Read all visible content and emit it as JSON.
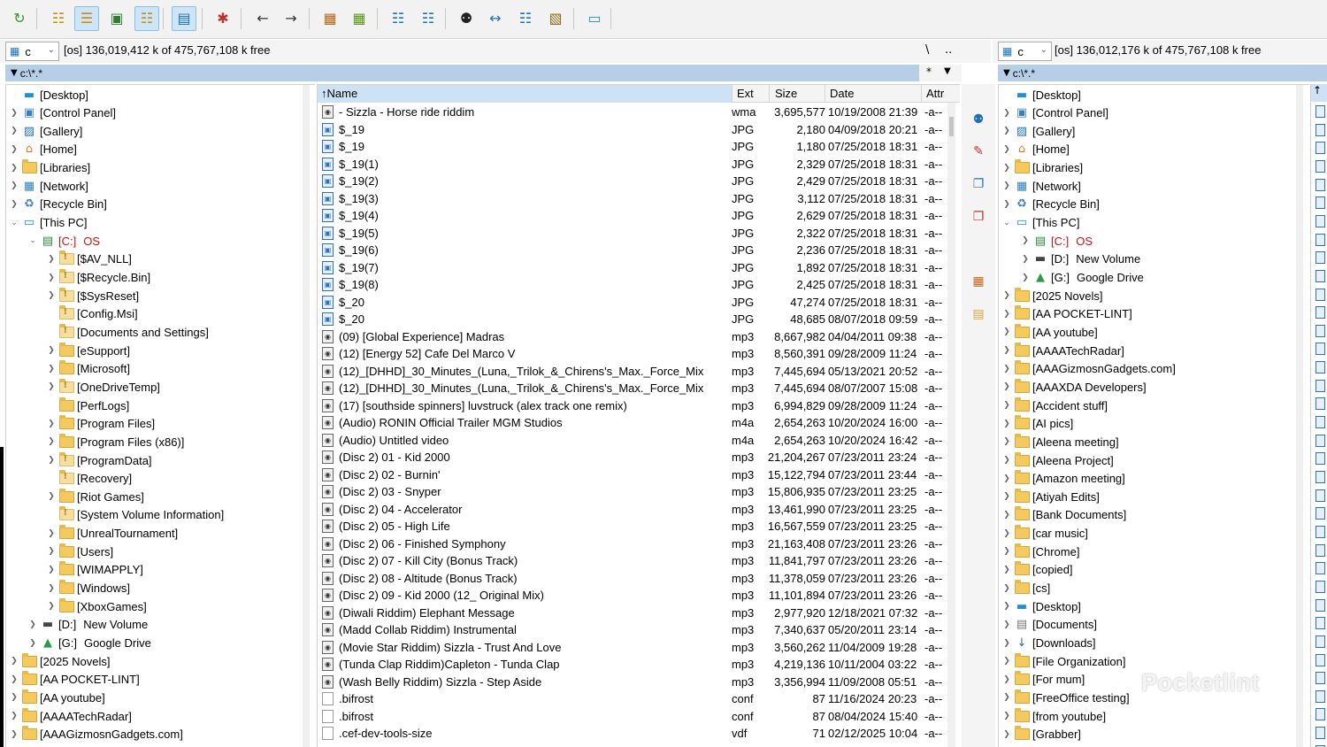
{
  "toolbar": {
    "buttons": [
      "refresh-icon",
      "brief-view-icon",
      "detailed-view-icon",
      "thumbnails-icon",
      "tree-view-icon",
      "quick-view-icon",
      "select-icon",
      "back-icon",
      "forward-icon",
      "pack-icon",
      "unpack-icon",
      "ftp-connect-icon",
      "url-connect-icon",
      "find-icon",
      "sync-dirs-icon",
      "compare-icon",
      "multi-rename-icon",
      "notepad-icon"
    ]
  },
  "left_drive": {
    "letter": "c",
    "info": "[os]  136,019,412 k of 475,767,108 k free",
    "root_btn": "\\",
    "up_btn": "..",
    "path": "c:\\*.*",
    "star": "*"
  },
  "right_drive": {
    "letter": "c",
    "info": "[os]  136,012,176 k of 475,767,108 k free",
    "path": "c:\\*.*"
  },
  "left_tree": [
    {
      "label": "[Desktop]",
      "icon": "desktop",
      "level": 0,
      "tog": ""
    },
    {
      "label": "[Control Panel]",
      "icon": "control-panel",
      "level": 0,
      "tog": ">"
    },
    {
      "label": "[Gallery]",
      "icon": "gallery",
      "level": 0,
      "tog": ">"
    },
    {
      "label": "[Home]",
      "icon": "home",
      "level": 0,
      "tog": ">"
    },
    {
      "label": "[Libraries]",
      "icon": "folder",
      "level": 0,
      "tog": ">"
    },
    {
      "label": "[Network]",
      "icon": "network",
      "level": 0,
      "tog": ">"
    },
    {
      "label": "[Recycle Bin]",
      "icon": "recycle",
      "level": 0,
      "tog": ">"
    },
    {
      "label": "[This PC]",
      "icon": "pc",
      "level": 0,
      "tog": "v"
    },
    {
      "label": "[C:]",
      "label2": "OS",
      "icon": "drive",
      "level": 1,
      "tog": "v",
      "red": true
    },
    {
      "label": "[$AV_NLL]",
      "icon": "sysfolder",
      "level": 2,
      "tog": ">"
    },
    {
      "label": "[$Recycle.Bin]",
      "icon": "sysfolder",
      "level": 2,
      "tog": ">"
    },
    {
      "label": "[$SysReset]",
      "icon": "sysfolder",
      "level": 2,
      "tog": ">"
    },
    {
      "label": "[Config.Msi]",
      "icon": "sysfolder",
      "level": 2,
      "tog": ""
    },
    {
      "label": "[Documents and Settings]",
      "icon": "sysfolder",
      "level": 2,
      "tog": ""
    },
    {
      "label": "[eSupport]",
      "icon": "folder",
      "level": 2,
      "tog": ">"
    },
    {
      "label": "[Microsoft]",
      "icon": "folder",
      "level": 2,
      "tog": ">"
    },
    {
      "label": "[OneDriveTemp]",
      "icon": "sysfolder",
      "level": 2,
      "tog": ">"
    },
    {
      "label": "[PerfLogs]",
      "icon": "folder",
      "level": 2,
      "tog": ""
    },
    {
      "label": "[Program Files]",
      "icon": "folder",
      "level": 2,
      "tog": ">"
    },
    {
      "label": "[Program Files (x86)]",
      "icon": "folder",
      "level": 2,
      "tog": ">"
    },
    {
      "label": "[ProgramData]",
      "icon": "sysfolder",
      "level": 2,
      "tog": ">"
    },
    {
      "label": "[Recovery]",
      "icon": "sysfolder",
      "level": 2,
      "tog": ""
    },
    {
      "label": "[Riot Games]",
      "icon": "folder",
      "level": 2,
      "tog": ">"
    },
    {
      "label": "[System Volume Information]",
      "icon": "sysfolder",
      "level": 2,
      "tog": ""
    },
    {
      "label": "[UnrealTournament]",
      "icon": "folder",
      "level": 2,
      "tog": ">"
    },
    {
      "label": "[Users]",
      "icon": "folder",
      "level": 2,
      "tog": ">"
    },
    {
      "label": "[WIMAPPLY]",
      "icon": "folder",
      "level": 2,
      "tog": ">"
    },
    {
      "label": "[Windows]",
      "icon": "folder",
      "level": 2,
      "tog": ">"
    },
    {
      "label": "[XboxGames]",
      "icon": "folder",
      "level": 2,
      "tog": ">"
    },
    {
      "label": "[D:]",
      "label2": "New Volume",
      "icon": "hdd",
      "level": 1,
      "tog": ">"
    },
    {
      "label": "[G:]",
      "label2": "Google Drive",
      "icon": "gdrive",
      "level": 1,
      "tog": ">"
    },
    {
      "label": "[2025 Novels]",
      "icon": "folder",
      "level": 0,
      "tog": ">"
    },
    {
      "label": "[AA POCKET-LINT]",
      "icon": "folder",
      "level": 0,
      "tog": ">"
    },
    {
      "label": "[AA youtube]",
      "icon": "folder",
      "level": 0,
      "tog": ">"
    },
    {
      "label": "[AAAATechRadar]",
      "icon": "folder",
      "level": 0,
      "tog": ">"
    },
    {
      "label": "[AAAGizmosnGadgets.com]",
      "icon": "folder",
      "level": 0,
      "tog": ">"
    }
  ],
  "right_tree": [
    {
      "label": "[Desktop]",
      "icon": "desktop",
      "level": 0,
      "tog": ""
    },
    {
      "label": "[Control Panel]",
      "icon": "control-panel",
      "level": 0,
      "tog": ">"
    },
    {
      "label": "[Gallery]",
      "icon": "gallery",
      "level": 0,
      "tog": ">"
    },
    {
      "label": "[Home]",
      "icon": "home",
      "level": 0,
      "tog": ">"
    },
    {
      "label": "[Libraries]",
      "icon": "folder",
      "level": 0,
      "tog": ">"
    },
    {
      "label": "[Network]",
      "icon": "network",
      "level": 0,
      "tog": ">"
    },
    {
      "label": "[Recycle Bin]",
      "icon": "recycle",
      "level": 0,
      "tog": ">"
    },
    {
      "label": "[This PC]",
      "icon": "pc",
      "level": 0,
      "tog": "v"
    },
    {
      "label": "[C:]",
      "label2": "OS",
      "icon": "drive",
      "level": 1,
      "tog": ">",
      "red": true
    },
    {
      "label": "[D:]",
      "label2": "New Volume",
      "icon": "hdd",
      "level": 1,
      "tog": ">"
    },
    {
      "label": "[G:]",
      "label2": "Google Drive",
      "icon": "gdrive",
      "level": 1,
      "tog": ">"
    },
    {
      "label": "[2025 Novels]",
      "icon": "folder",
      "level": 0,
      "tog": ">"
    },
    {
      "label": "[AA POCKET-LINT]",
      "icon": "folder",
      "level": 0,
      "tog": ">"
    },
    {
      "label": "[AA youtube]",
      "icon": "folder",
      "level": 0,
      "tog": ">"
    },
    {
      "label": "[AAAATechRadar]",
      "icon": "folder",
      "level": 0,
      "tog": ">"
    },
    {
      "label": "[AAAGizmosnGadgets.com]",
      "icon": "folder",
      "level": 0,
      "tog": ">"
    },
    {
      "label": "[AAAXDA Developers]",
      "icon": "folder",
      "level": 0,
      "tog": ">"
    },
    {
      "label": "[Accident stuff]",
      "icon": "folder",
      "level": 0,
      "tog": ">"
    },
    {
      "label": "[AI pics]",
      "icon": "folder",
      "level": 0,
      "tog": ">"
    },
    {
      "label": "[Aleena meeting]",
      "icon": "folder",
      "level": 0,
      "tog": ">"
    },
    {
      "label": "[Aleena Project]",
      "icon": "folder",
      "level": 0,
      "tog": ">"
    },
    {
      "label": "[Amazon meeting]",
      "icon": "folder",
      "level": 0,
      "tog": ">"
    },
    {
      "label": "[Atiyah Edits]",
      "icon": "folder",
      "level": 0,
      "tog": ">"
    },
    {
      "label": "[Bank Documents]",
      "icon": "folder",
      "level": 0,
      "tog": ">"
    },
    {
      "label": "[car music]",
      "icon": "folder",
      "level": 0,
      "tog": ">"
    },
    {
      "label": "[Chrome]",
      "icon": "folder",
      "level": 0,
      "tog": ">"
    },
    {
      "label": "[copied]",
      "icon": "folder",
      "level": 0,
      "tog": ">"
    },
    {
      "label": "[cs]",
      "icon": "folder",
      "level": 0,
      "tog": ">"
    },
    {
      "label": "[Desktop]",
      "icon": "desktop",
      "level": 0,
      "tog": ">"
    },
    {
      "label": "[Documents]",
      "icon": "documents",
      "level": 0,
      "tog": ">"
    },
    {
      "label": "[Downloads]",
      "icon": "downloads",
      "level": 0,
      "tog": ">"
    },
    {
      "label": "[File Organization]",
      "icon": "folder",
      "level": 0,
      "tog": ">"
    },
    {
      "label": "[For mum]",
      "icon": "folder",
      "level": 0,
      "tog": ">"
    },
    {
      "label": "[FreeOffice testing]",
      "icon": "folder",
      "level": 0,
      "tog": ">"
    },
    {
      "label": "[from youtube]",
      "icon": "folder",
      "level": 0,
      "tog": ">"
    },
    {
      "label": "[Grabber]",
      "icon": "folder",
      "level": 0,
      "tog": ">"
    }
  ],
  "filelist": {
    "headers": {
      "name": "Name",
      "ext": "Ext",
      "size": "Size",
      "date": "Date",
      "attr": "Attr"
    },
    "sort_arrow": "↑",
    "rows": [
      {
        "name": "- Sizzla - Horse ride riddim",
        "ext": "wma",
        "size": "3,695,577",
        "date": "10/19/2008 21:39",
        "attr": "-a--",
        "type": "aud"
      },
      {
        "name": "$_19",
        "ext": "JPG",
        "size": "2,180",
        "date": "04/09/2018 20:21",
        "attr": "-a--",
        "type": "img"
      },
      {
        "name": "$_19",
        "ext": "JPG",
        "size": "1,180",
        "date": "07/25/2018 18:31",
        "attr": "-a--",
        "type": "img"
      },
      {
        "name": "$_19(1)",
        "ext": "JPG",
        "size": "2,329",
        "date": "07/25/2018 18:31",
        "attr": "-a--",
        "type": "img"
      },
      {
        "name": "$_19(2)",
        "ext": "JPG",
        "size": "2,429",
        "date": "07/25/2018 18:31",
        "attr": "-a--",
        "type": "img"
      },
      {
        "name": "$_19(3)",
        "ext": "JPG",
        "size": "3,112",
        "date": "07/25/2018 18:31",
        "attr": "-a--",
        "type": "img"
      },
      {
        "name": "$_19(4)",
        "ext": "JPG",
        "size": "2,629",
        "date": "07/25/2018 18:31",
        "attr": "-a--",
        "type": "img"
      },
      {
        "name": "$_19(5)",
        "ext": "JPG",
        "size": "2,322",
        "date": "07/25/2018 18:31",
        "attr": "-a--",
        "type": "img"
      },
      {
        "name": "$_19(6)",
        "ext": "JPG",
        "size": "2,236",
        "date": "07/25/2018 18:31",
        "attr": "-a--",
        "type": "img"
      },
      {
        "name": "$_19(7)",
        "ext": "JPG",
        "size": "1,892",
        "date": "07/25/2018 18:31",
        "attr": "-a--",
        "type": "img"
      },
      {
        "name": "$_19(8)",
        "ext": "JPG",
        "size": "2,425",
        "date": "07/25/2018 18:31",
        "attr": "-a--",
        "type": "img"
      },
      {
        "name": "$_20",
        "ext": "JPG",
        "size": "47,274",
        "date": "07/25/2018 18:31",
        "attr": "-a--",
        "type": "img"
      },
      {
        "name": "$_20",
        "ext": "JPG",
        "size": "48,685",
        "date": "08/07/2018 09:59",
        "attr": "-a--",
        "type": "img"
      },
      {
        "name": "(09) [Global Experience] Madras",
        "ext": "mp3",
        "size": "8,667,982",
        "date": "04/04/2011 09:38",
        "attr": "-a--",
        "type": "aud"
      },
      {
        "name": "(12) [Energy 52] Cafe Del Marco V",
        "ext": "mp3",
        "size": "8,560,391",
        "date": "09/28/2009 11:24",
        "attr": "-a--",
        "type": "aud"
      },
      {
        "name": "(12)_[DHHD]_30_Minutes_(Luna,_Trilok_&_Chirens's_Max._Force_Mix",
        "ext": "mp3",
        "size": "7,445,694",
        "date": "05/13/2021 20:52",
        "attr": "-a--",
        "type": "aud"
      },
      {
        "name": "(12)_[DHHD]_30_Minutes_(Luna,_Trilok_&_Chirens's_Max._Force_Mix",
        "ext": "mp3",
        "size": "7,445,694",
        "date": "08/07/2007 15:08",
        "attr": "-a--",
        "type": "aud"
      },
      {
        "name": "(17) [southside spinners] luvstruck (alex track one remix)",
        "ext": "mp3",
        "size": "6,994,829",
        "date": "09/28/2009 11:24",
        "attr": "-a--",
        "type": "aud"
      },
      {
        "name": "(Audio) RONIN  Official Trailer  MGM Studios",
        "ext": "m4a",
        "size": "2,654,263",
        "date": "10/20/2024 16:00",
        "attr": "-a--",
        "type": "aud"
      },
      {
        "name": "(Audio) Untitled video",
        "ext": "m4a",
        "size": "2,654,263",
        "date": "10/20/2024 16:42",
        "attr": "-a--",
        "type": "aud"
      },
      {
        "name": "(Disc 2) 01 - Kid 2000",
        "ext": "mp3",
        "size": "21,204,267",
        "date": "07/23/2011 23:24",
        "attr": "-a--",
        "type": "aud"
      },
      {
        "name": "(Disc 2) 02 - Burnin'",
        "ext": "mp3",
        "size": "15,122,794",
        "date": "07/23/2011 23:44",
        "attr": "-a--",
        "type": "aud"
      },
      {
        "name": "(Disc 2) 03 - Snyper",
        "ext": "mp3",
        "size": "15,806,935",
        "date": "07/23/2011 23:25",
        "attr": "-a--",
        "type": "aud"
      },
      {
        "name": "(Disc 2) 04 - Accelerator",
        "ext": "mp3",
        "size": "13,461,990",
        "date": "07/23/2011 23:25",
        "attr": "-a--",
        "type": "aud"
      },
      {
        "name": "(Disc 2) 05 - High Life",
        "ext": "mp3",
        "size": "16,567,559",
        "date": "07/23/2011 23:25",
        "attr": "-a--",
        "type": "aud"
      },
      {
        "name": "(Disc 2) 06 - Finished Symphony",
        "ext": "mp3",
        "size": "21,163,408",
        "date": "07/23/2011 23:26",
        "attr": "-a--",
        "type": "aud"
      },
      {
        "name": "(Disc 2) 07 - Kill City (Bonus Track)",
        "ext": "mp3",
        "size": "11,841,797",
        "date": "07/23/2011 23:26",
        "attr": "-a--",
        "type": "aud"
      },
      {
        "name": "(Disc 2) 08 - Altitude (Bonus Track)",
        "ext": "mp3",
        "size": "11,378,059",
        "date": "07/23/2011 23:26",
        "attr": "-a--",
        "type": "aud"
      },
      {
        "name": "(Disc 2) 09 - Kid 2000 (12_ Original Mix)",
        "ext": "mp3",
        "size": "11,101,894",
        "date": "07/23/2011 23:26",
        "attr": "-a--",
        "type": "aud"
      },
      {
        "name": "(Diwali Riddim) Elephant Message",
        "ext": "mp3",
        "size": "2,977,920",
        "date": "12/18/2021 07:32",
        "attr": "-a--",
        "type": "aud"
      },
      {
        "name": "(Madd Collab Riddim) Instrumental",
        "ext": "mp3",
        "size": "7,340,637",
        "date": "05/20/2011 23:14",
        "attr": "-a--",
        "type": "aud"
      },
      {
        "name": "(Movie Star Riddim) Sizzla - Trust And Love",
        "ext": "mp3",
        "size": "3,560,262",
        "date": "11/04/2009 19:28",
        "attr": "-a--",
        "type": "aud"
      },
      {
        "name": "(Tunda Clap Riddim)Capleton - Tunda Clap",
        "ext": "mp3",
        "size": "4,219,136",
        "date": "10/11/2004 03:22",
        "attr": "-a--",
        "type": "aud"
      },
      {
        "name": "(Wash Belly Riddim) Sizzla - Step Aside",
        "ext": "mp3",
        "size": "3,356,994",
        "date": "11/09/2008 05:51",
        "attr": "-a--",
        "type": "aud"
      },
      {
        "name": ".bifrost",
        "ext": "conf",
        "size": "87",
        "date": "11/16/2024 20:23",
        "attr": "-a--",
        "type": "doc"
      },
      {
        "name": ".bifrost",
        "ext": "conf",
        "size": "87",
        "date": "08/04/2024 15:40",
        "attr": "-a--",
        "type": "doc"
      },
      {
        "name": ".cef-dev-tools-size",
        "ext": "vdf",
        "size": "71",
        "date": "02/12/2025 10:04",
        "attr": "-a--",
        "type": "doc"
      }
    ]
  },
  "midstrip": [
    "view-file-icon",
    "edit-file-icon",
    "copy-file-icon",
    "move-file-icon",
    "pack-files-icon",
    "new-folder-icon"
  ],
  "watermark": "Pocketlint",
  "colors": {
    "pathbar": "#b7cfe6",
    "header_sorted": "#cde3f5",
    "folder": "#f4c95d",
    "drive_red": "#d01010"
  }
}
